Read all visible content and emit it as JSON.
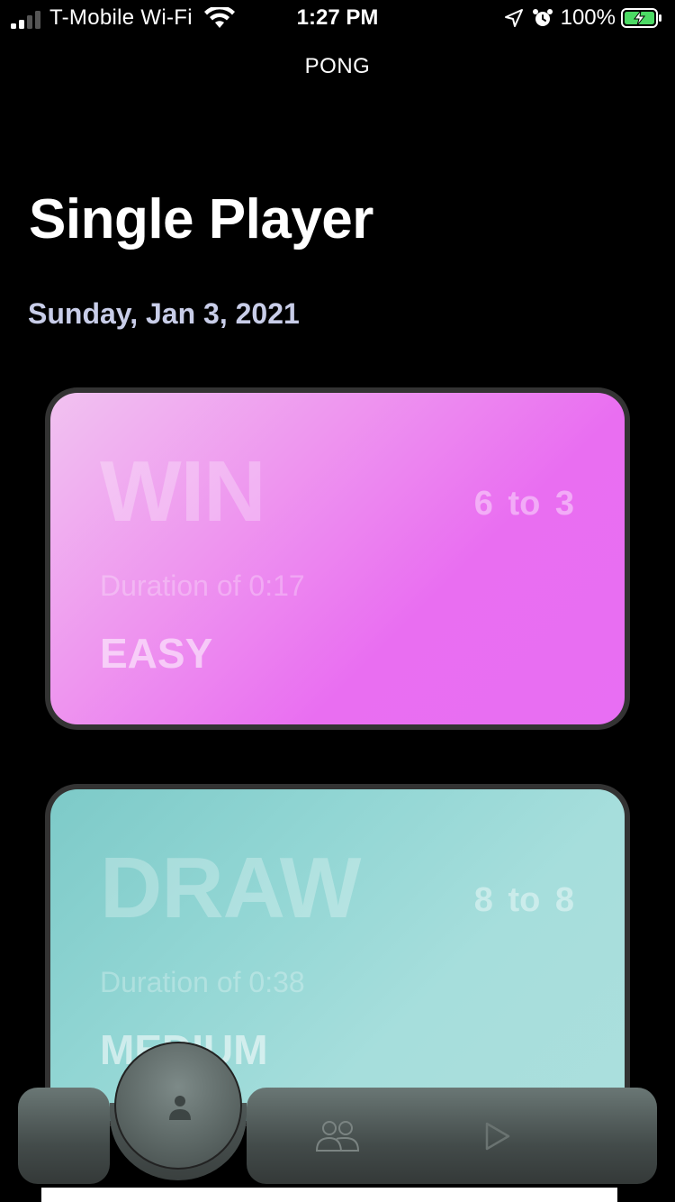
{
  "status_bar": {
    "carrier": "T-Mobile Wi-Fi",
    "time": "1:27 PM",
    "battery_percent": "100%",
    "icons": [
      "signal-icon",
      "wifi-icon",
      "location-icon",
      "alarm-icon",
      "battery-charging-icon"
    ]
  },
  "nav": {
    "title": "PONG"
  },
  "page": {
    "title": "Single Player",
    "section_date": "Sunday, Jan 3, 2021"
  },
  "games": [
    {
      "result": "WIN",
      "score": "6 to 3",
      "duration": "Duration of  0:17",
      "difficulty": "EASY",
      "color": "#e86ef3"
    },
    {
      "result": "DRAW",
      "score": "8 to 8",
      "duration": "Duration of  0:38",
      "difficulty": "MEDIUM",
      "color": "#7dcac8"
    }
  ],
  "tab_bar": {
    "items": [
      {
        "icon": "person-icon",
        "selected": true
      },
      {
        "icon": "group-icon",
        "selected": false
      },
      {
        "icon": "play-icon",
        "selected": false
      }
    ]
  }
}
